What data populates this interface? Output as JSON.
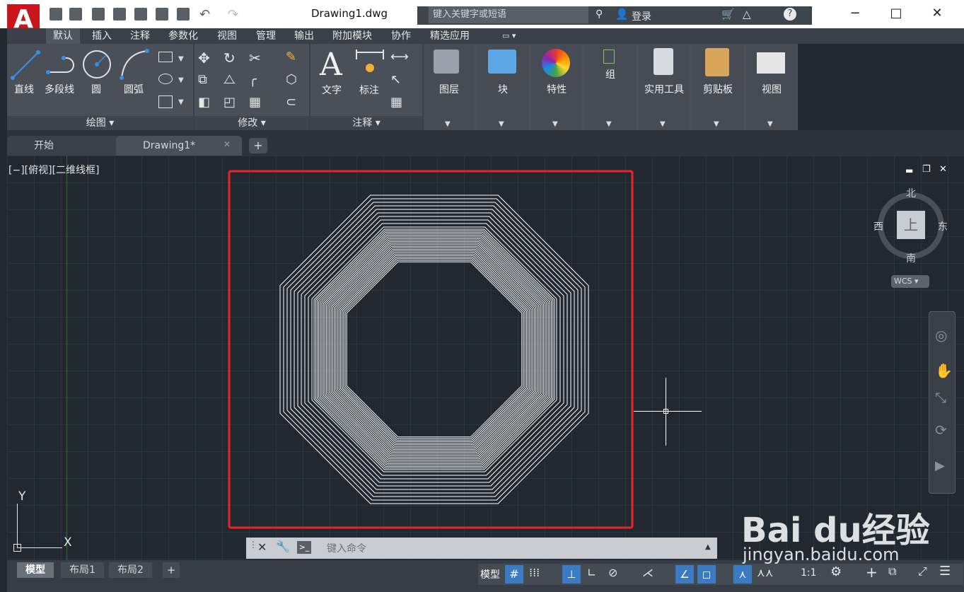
{
  "window": {
    "title": "Drawing1.dwg",
    "search_placeholder": "键入关键字或短语",
    "login": "登录"
  },
  "ribbon_tabs": [
    "默认",
    "插入",
    "注释",
    "参数化",
    "视图",
    "管理",
    "输出",
    "附加模块",
    "协作",
    "精选应用"
  ],
  "panels": {
    "draw": {
      "title": "绘图",
      "tools": [
        "直线",
        "多段线",
        "圆",
        "圆弧"
      ]
    },
    "modify": {
      "title": "修改"
    },
    "annotation": {
      "title": "注释",
      "tools": [
        "文字",
        "标注"
      ]
    },
    "big_buttons": [
      "图层",
      "块",
      "特性",
      "组",
      "实用工具",
      "剪贴板",
      "视图"
    ]
  },
  "file_tabs": [
    "开始",
    "Drawing1*"
  ],
  "viewport": {
    "label": "[−][俯视][二维线框]",
    "compass": {
      "north": "北",
      "south": "南",
      "east": "东",
      "west": "西",
      "top": "上"
    },
    "wcs": "WCS",
    "axis_y": "Y",
    "axis_x": "X"
  },
  "command_line": {
    "placeholder": "键入命令"
  },
  "layout_tabs": [
    "模型",
    "布局1",
    "布局2"
  ],
  "status": {
    "model": "模型",
    "scale": "1:1"
  },
  "watermark": {
    "brand": "Bai du经验",
    "url": "jingyan.baidu.com"
  },
  "colors": {
    "accent_red": "#c8161d",
    "highlight_box": "#e8252a",
    "ribbon": "#4b5058"
  }
}
